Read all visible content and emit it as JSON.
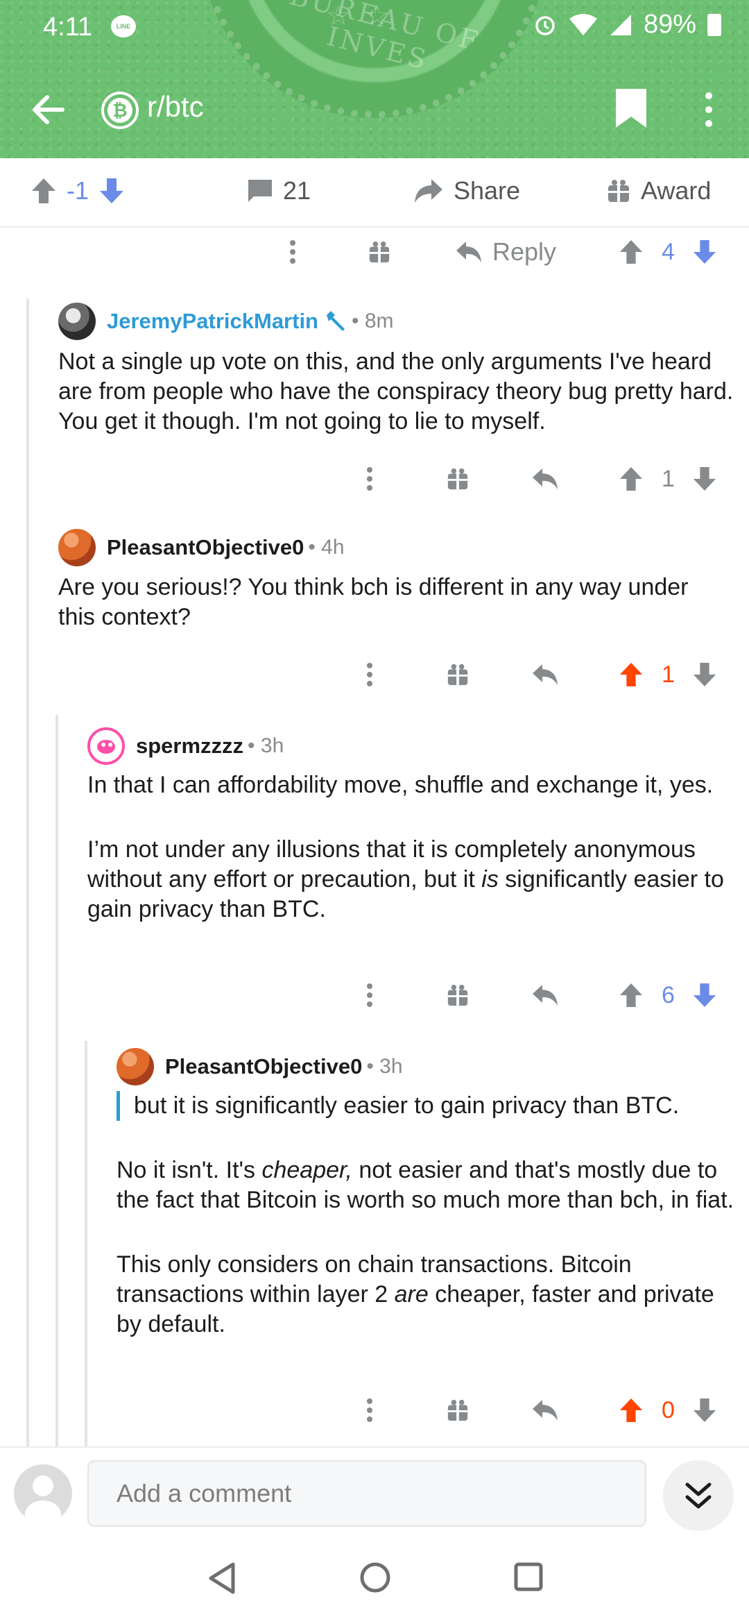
{
  "status_bar": {
    "time": "4:11",
    "line_icon": "LINE",
    "battery": "89%"
  },
  "header": {
    "seal_text": "BUREAU OF INVES",
    "seal_stars": "☆☆",
    "subreddit": "r/btc",
    "subreddit_icon_glyph": "₿"
  },
  "post_actions": {
    "score": "-1",
    "comments_count": "21",
    "share_label": "Share",
    "award_label": "Award"
  },
  "parent_action_row": {
    "reply_label": "Reply",
    "score": "4"
  },
  "comments": [
    {
      "author": "JeremyPatrickMartin",
      "age": "8m",
      "body": "Not a single up vote on this, and the only arguments I've heard are from people who have the conspiracy theory bug pretty hard. You get it though. I'm not going to lie to myself.",
      "score": "1"
    },
    {
      "author": "PleasantObjective0",
      "age": "4h",
      "body": "Are you serious!? You think bch is different in any way under this context?",
      "score": "1"
    },
    {
      "author": "spermzzzz",
      "age": "3h",
      "body_p1": "In that I can affordability move, shuffle and exchange it, yes.",
      "body_p2_a": "I’m not under any illusions that it is completely anonymous without any effort or precaution, but it ",
      "body_p2_em": "is",
      "body_p2_b": " significantly easier to gain privacy than BTC.",
      "score": "6"
    },
    {
      "author": "PleasantObjective0",
      "age": "3h",
      "quote": "but it is significantly easier to gain privacy than BTC.",
      "body_p1_a": "No it isn't.  It's ",
      "body_p1_em": "cheaper,",
      "body_p1_b": " not easier and that's mostly due to the fact that Bitcoin is worth so much more than bch, in fiat.",
      "body_p2_a": "This only considers on chain transactions. Bitcoin transactions within layer 2 ",
      "body_p2_em": "are",
      "body_p2_b": " cheaper, faster and private by default.",
      "score": "0"
    }
  ],
  "composer": {
    "placeholder": "Add a comment"
  },
  "colors": {
    "header_green": "#6cc071",
    "downvote_blue": "#6a8ce8",
    "upvote_orange": "#ff4500",
    "op_blue": "#2e9bd6"
  }
}
